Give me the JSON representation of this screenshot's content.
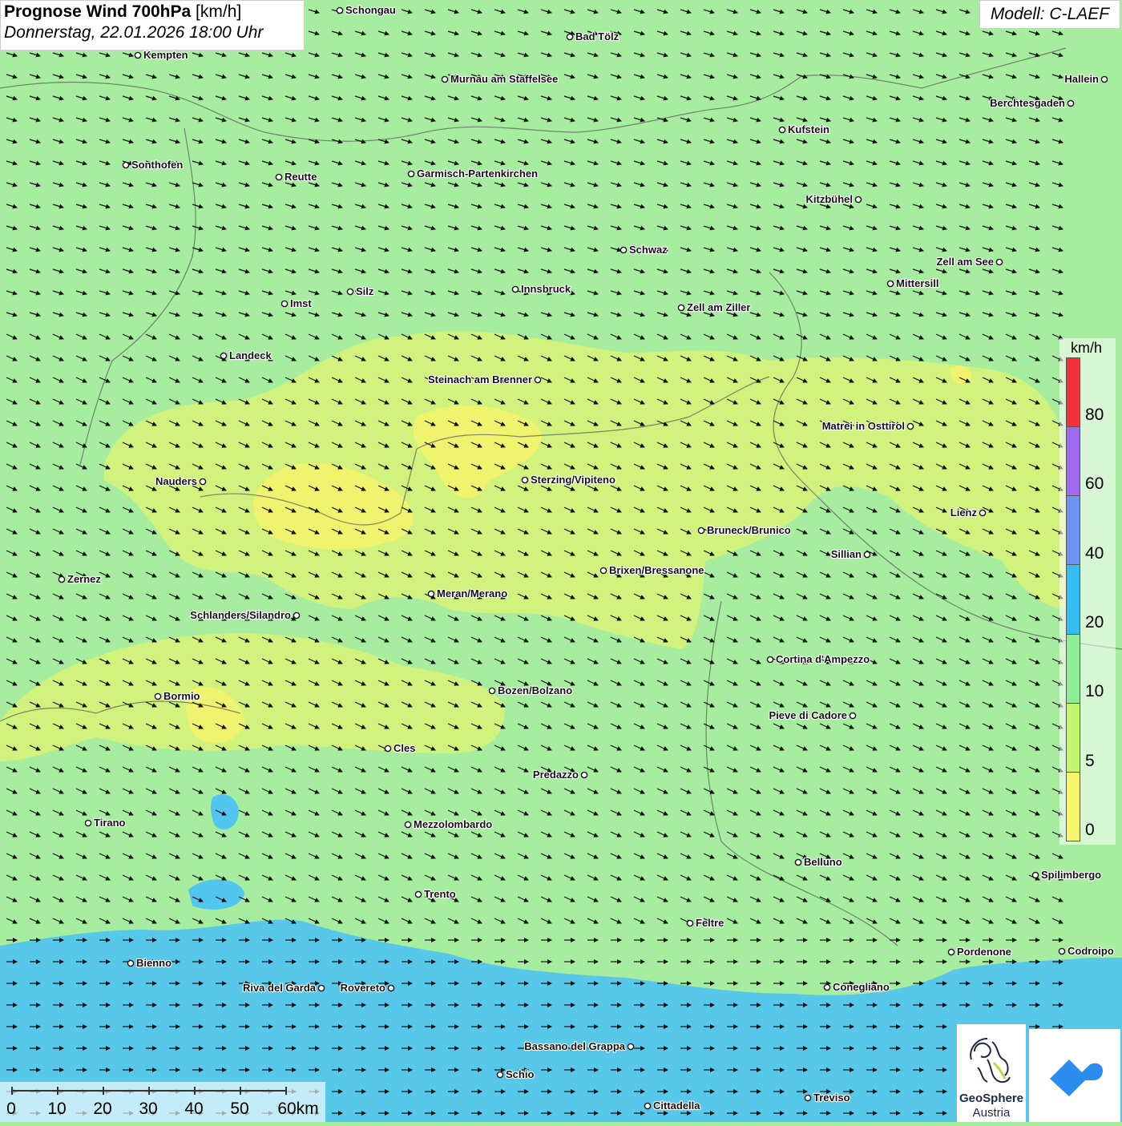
{
  "title": {
    "bold": "Prognose Wind 700hPa",
    "unit": "[km/h]",
    "datetime": "Donnerstag, 22.01.2026 18:00 Uhr"
  },
  "model": "Modell: C-LAEF",
  "legend": {
    "unit": "km/h",
    "ticks": [
      "80",
      "60",
      "40",
      "20",
      "10",
      "5",
      "0"
    ],
    "colors": [
      "#f2313a",
      "#f2313a",
      "#a06af0",
      "#a06af0",
      "#6f93f2",
      "#6f93f2",
      "#34bdf0",
      "#34bdf0",
      "#8fed98",
      "#8fed98",
      "#c4f56c",
      "#c4f56c",
      "#f7f36a",
      "#f7f36a"
    ]
  },
  "scalebar": {
    "ticks": [
      "0",
      "10",
      "20",
      "30",
      "40",
      "50",
      "60km"
    ]
  },
  "logo": {
    "line1": "GeoSphere",
    "line2": "Austria"
  },
  "cities": [
    {
      "name": "Schongau"
    },
    {
      "name": "Bad Tölz"
    },
    {
      "name": "Kempten"
    },
    {
      "name": "Murnau am Staffelsee"
    },
    {
      "name": "Hallein"
    },
    {
      "name": "Berchtesgaden"
    },
    {
      "name": "Kufstein"
    },
    {
      "name": "Sonthofen"
    },
    {
      "name": "Reutte"
    },
    {
      "name": "Garmisch-Partenkirchen"
    },
    {
      "name": "Kitzbühel"
    },
    {
      "name": "Schwaz"
    },
    {
      "name": "Zell am See"
    },
    {
      "name": "Mittersill"
    },
    {
      "name": "Innsbruck"
    },
    {
      "name": "Silz"
    },
    {
      "name": "Imst"
    },
    {
      "name": "Zell am Ziller"
    },
    {
      "name": "Landeck"
    },
    {
      "name": "Steinach am Brenner"
    },
    {
      "name": "Matrei in Osttirol"
    },
    {
      "name": "Nauders"
    },
    {
      "name": "Sterzing/Vipiteno"
    },
    {
      "name": "Lienz"
    },
    {
      "name": "Bruneck/Brunico"
    },
    {
      "name": "Sillian"
    },
    {
      "name": "Zernez"
    },
    {
      "name": "Brixen/Bressanone"
    },
    {
      "name": "Meran/Merano"
    },
    {
      "name": "Schlanders/Silandro"
    },
    {
      "name": "Cortina d'Ampezzo"
    },
    {
      "name": "Bozen/Bolzano"
    },
    {
      "name": "Bormio"
    },
    {
      "name": "Pieve di Cadore"
    },
    {
      "name": "Cles"
    },
    {
      "name": "Predazzo"
    },
    {
      "name": "Tirano"
    },
    {
      "name": "Mezzolombardo"
    },
    {
      "name": "Belluno"
    },
    {
      "name": "Spilimbergo"
    },
    {
      "name": "Trento"
    },
    {
      "name": "Feltre"
    },
    {
      "name": "Pordenone"
    },
    {
      "name": "Codroipo"
    },
    {
      "name": "Bienno"
    },
    {
      "name": "Riva del Garda"
    },
    {
      "name": "Rovereto"
    },
    {
      "name": "Conegliano"
    },
    {
      "name": "Bassano del Grappa"
    },
    {
      "name": "Schio"
    },
    {
      "name": "Treviso"
    },
    {
      "name": "Cittadella"
    }
  ],
  "wind_field": {
    "direction": "west-northwest",
    "speed_classes": [
      "10-20 km/h",
      "5-10 km/h",
      "20-40 km/h"
    ]
  }
}
